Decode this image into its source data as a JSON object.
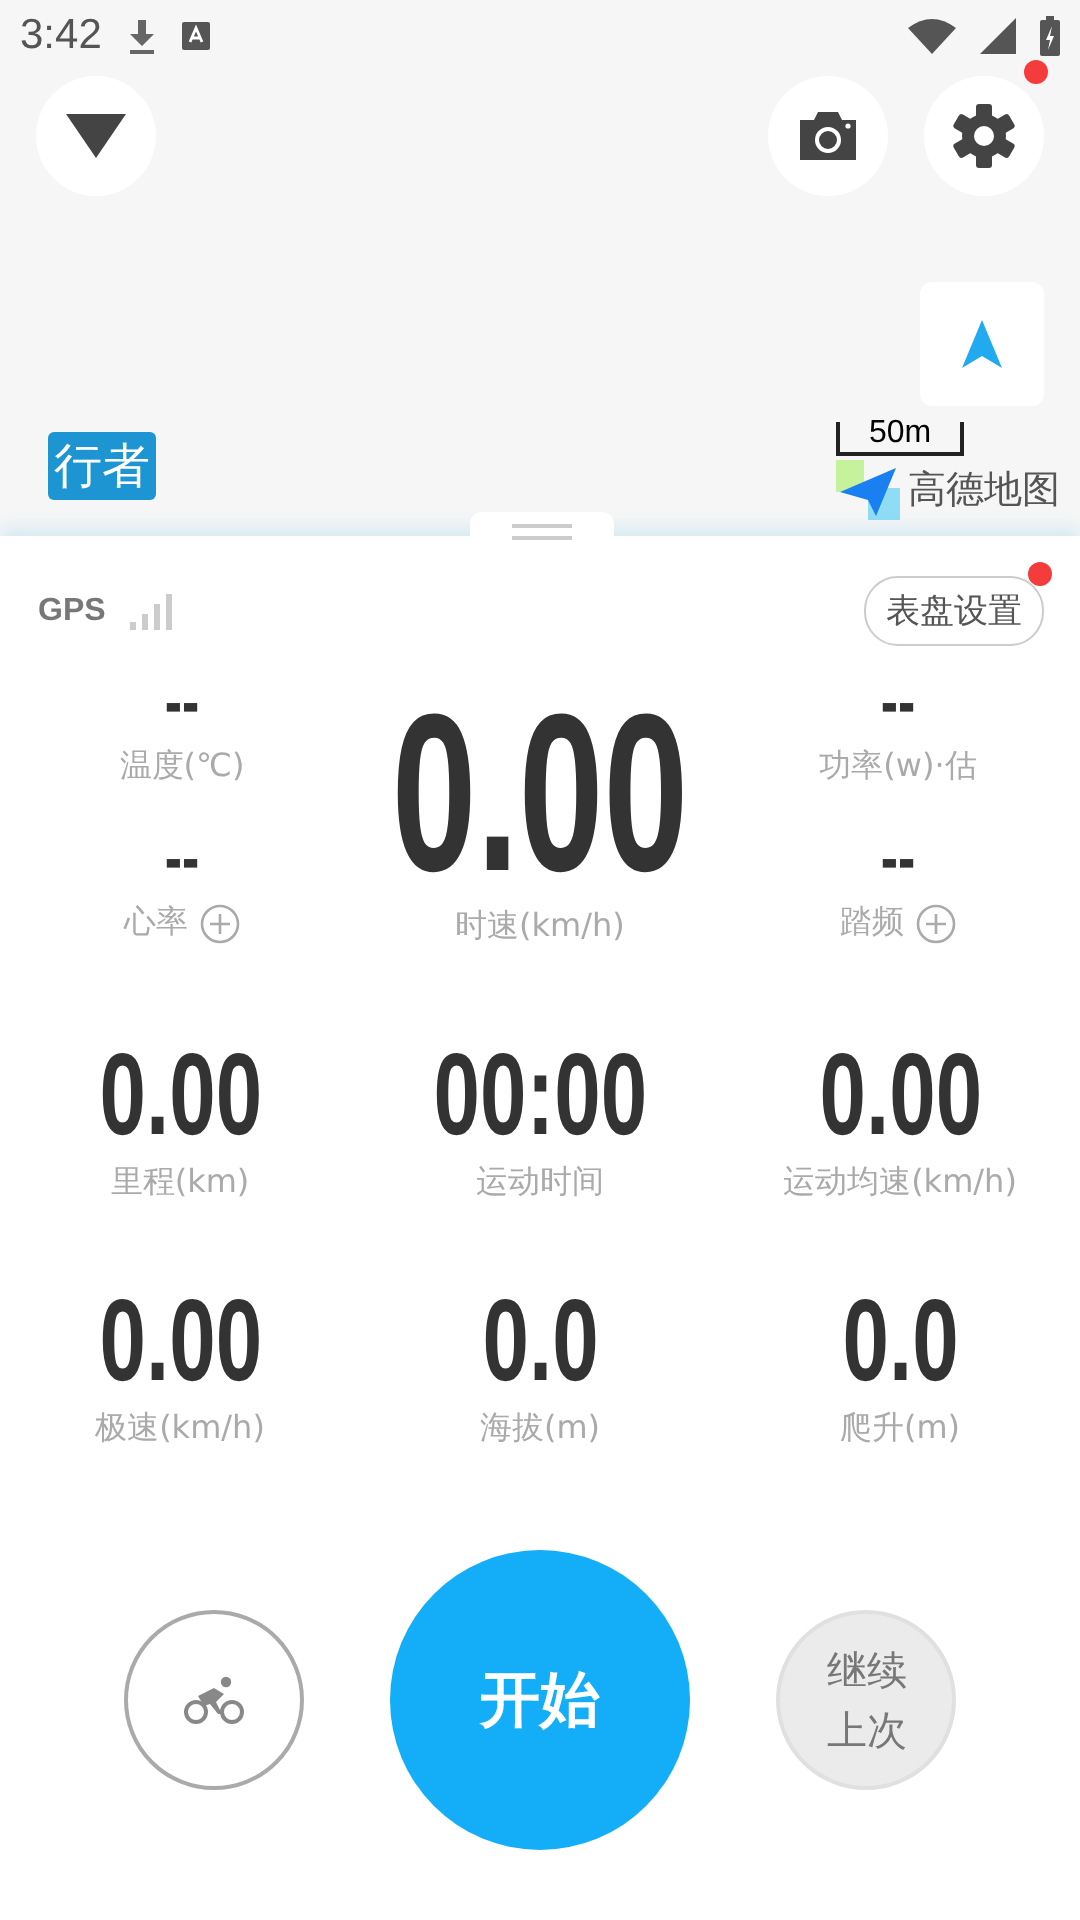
{
  "status_bar": {
    "time": "3:42"
  },
  "map": {
    "logo": "行者",
    "scale": "50m",
    "provider": "高德地图",
    "settings_badge": true
  },
  "dashboard": {
    "gps_label": "GPS",
    "settings_button": {
      "label": "表盘设置",
      "badge": true
    },
    "left": [
      {
        "value": "--",
        "label": "温度(℃)",
        "add_button": false
      },
      {
        "value": "--",
        "label": "心率",
        "add_button": true
      }
    ],
    "main": {
      "value": "0.00",
      "label": "时速(km/h)"
    },
    "right": [
      {
        "value": "--",
        "label": "功率(w)·估",
        "add_button": false
      },
      {
        "value": "--",
        "label": "踏频",
        "add_button": true
      }
    ],
    "grid": [
      {
        "value": "0.00",
        "label": "里程(km)"
      },
      {
        "value": "00:00",
        "label": "运动时间"
      },
      {
        "value": "0.00",
        "label": "运动均速(km/h)"
      },
      {
        "value": "0.00",
        "label": "极速(km/h)"
      },
      {
        "value": "0.0",
        "label": "海拔(m)"
      },
      {
        "value": "0.0",
        "label": "爬升(m)"
      }
    ]
  },
  "actions": {
    "start": "开始",
    "resume": "继续上次"
  }
}
